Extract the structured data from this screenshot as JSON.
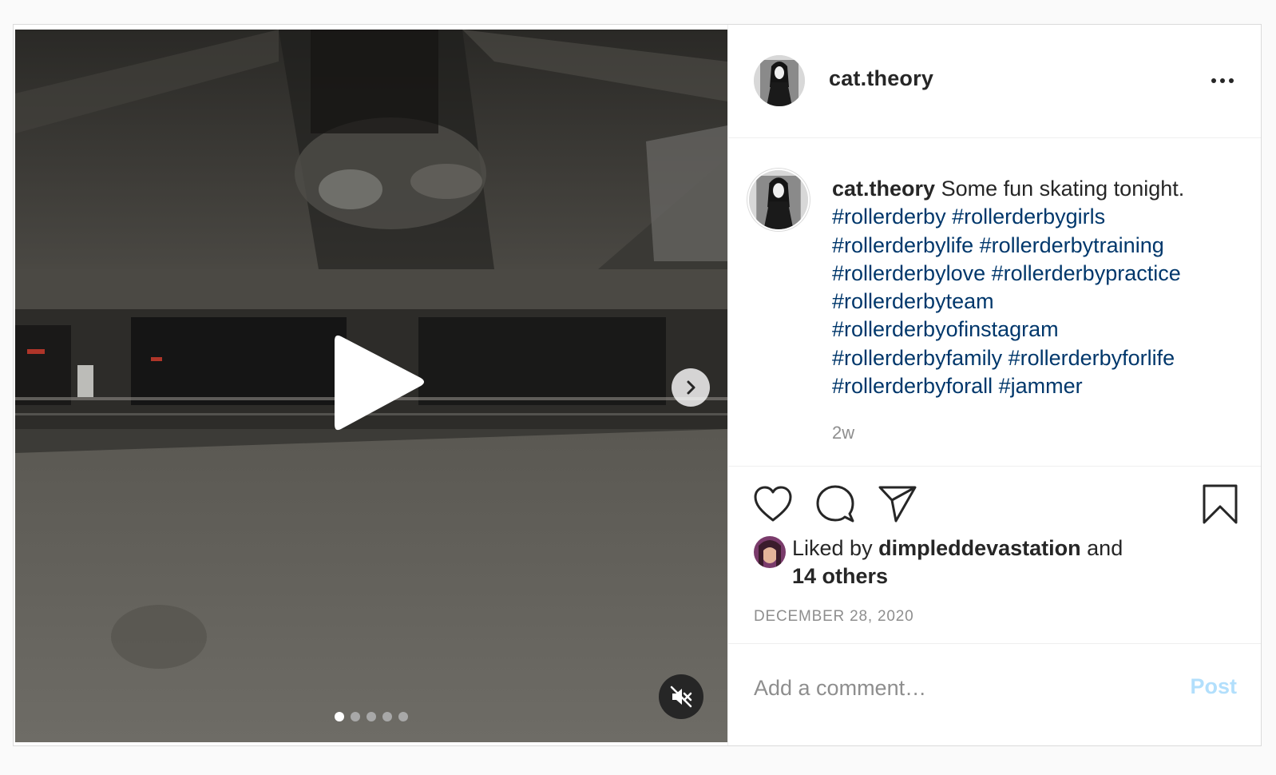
{
  "post": {
    "username": "cat.theory",
    "caption": {
      "username": "cat.theory",
      "text": "Some fun skating tonight.",
      "hashtags": [
        "#rollerderby",
        "#rollerderbygirls",
        "#rollerderbylife",
        "#rollerderbytraining",
        "#rollerderbylove",
        "#rollerderbypractice",
        "#rollerderbyteam",
        "#rollerderbyofinstagram",
        "#rollerderbyfamily",
        "#rollerderbyforlife",
        "#rollerderbyforall",
        "#jammer"
      ]
    },
    "time_ago": "2w",
    "likes": {
      "prefix": "Liked by",
      "user": "dimpleddevastation",
      "connector": "and",
      "others": "14 others"
    },
    "date": "DECEMBER 28, 2020",
    "comment": {
      "placeholder": "Add a comment…",
      "post_label": "Post"
    }
  },
  "media": {
    "type": "video",
    "slides_total": 5,
    "active_slide": 1,
    "muted": true
  },
  "icons": {
    "header": [
      "avatar",
      "more-icon"
    ],
    "actions": [
      "heart-icon",
      "comment-icon",
      "share-icon",
      "bookmark-icon"
    ],
    "media": [
      "play-icon",
      "chevron-right-icon",
      "mute-icon"
    ]
  },
  "colors": {
    "hashtag": "#00376b",
    "post_button": "#b2dffc",
    "muted_text": "#8e8e8e",
    "text": "#262626"
  }
}
